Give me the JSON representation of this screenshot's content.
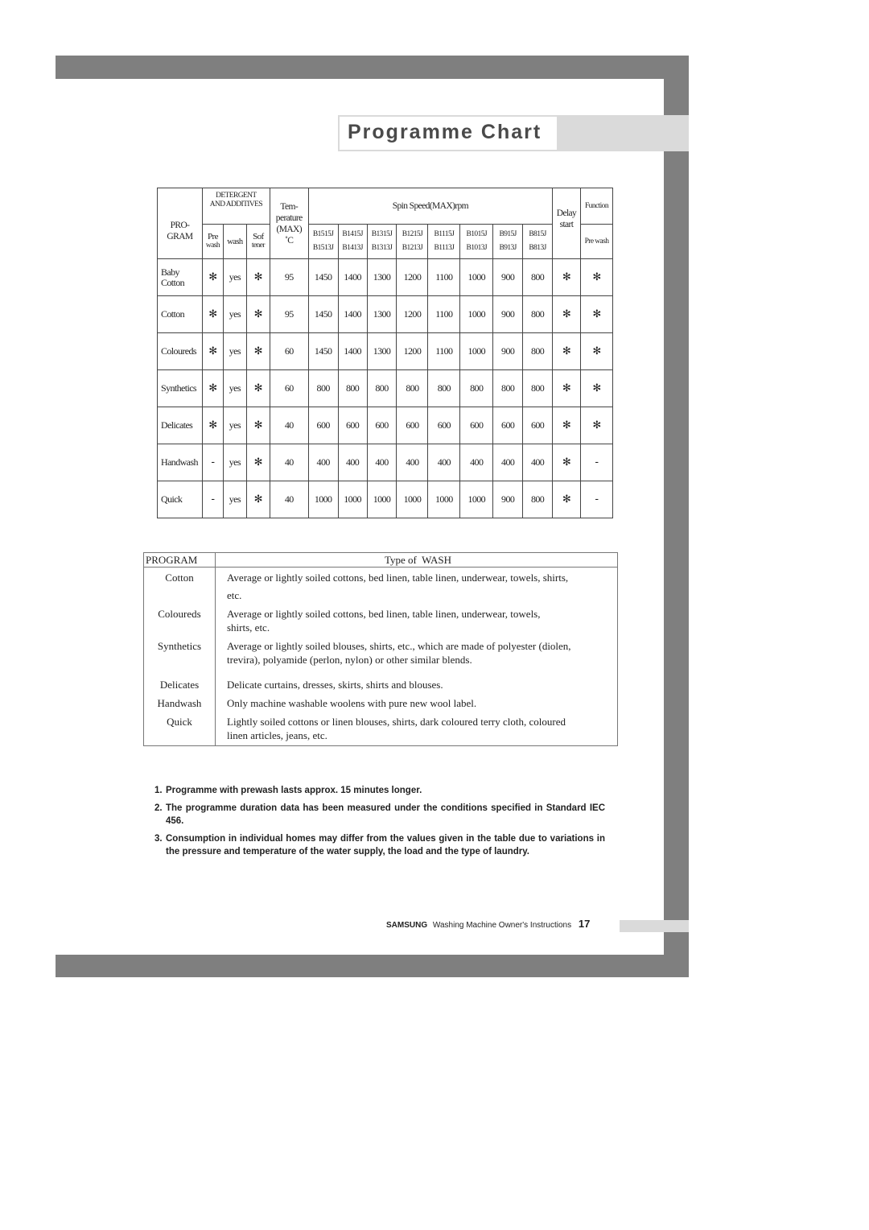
{
  "title": "Programme Chart",
  "program_table": {
    "headers": {
      "program": "PRO-GRAM",
      "program_line1": "PRO-",
      "program_line2": "GRAM",
      "detergent_line1": "DETERGENT",
      "detergent_line2": "AND ADDITIVES",
      "prewash_line1": "Pre",
      "prewash_line2": "wash",
      "wash": "wash",
      "softener_line1": "Sof",
      "softener_line2": "tener",
      "temp_line1": "Tem-",
      "temp_line2": "perature",
      "temp_line3": "(MAX)",
      "temp_line4": "˚C",
      "spin": "Spin Speed(MAX)rpm",
      "delay_line1": "Delay",
      "delay_line2": "start",
      "function": "Function",
      "function_prewash": "Pre wash"
    },
    "models": [
      {
        "top": "B1515J",
        "bottom": "B1513J"
      },
      {
        "top": "B1415J",
        "bottom": "B1413J"
      },
      {
        "top": "B1315J",
        "bottom": "B1313J"
      },
      {
        "top": "B1215J",
        "bottom": "B1213J"
      },
      {
        "top": "B1115J",
        "bottom": "B1113J"
      },
      {
        "top": "B1015J",
        "bottom": "B1013J"
      },
      {
        "top": "B915J",
        "bottom": "B913J"
      },
      {
        "top": "B815J",
        "bottom": "B813J"
      }
    ],
    "rows": [
      {
        "program_line1": "Baby",
        "program_line2": "Cotton",
        "prewash": "✻",
        "wash": "yes",
        "softener": "✻",
        "temp": "95",
        "spin": [
          "1450",
          "1400",
          "1300",
          "1200",
          "1100",
          "1000",
          "900",
          "800"
        ],
        "delay": "✻",
        "prewash_fn": "✻"
      },
      {
        "program_line1": "",
        "program_line2": "Cotton",
        "prewash": "✻",
        "wash": "yes",
        "softener": "✻",
        "temp": "95",
        "spin": [
          "1450",
          "1400",
          "1300",
          "1200",
          "1100",
          "1000",
          "900",
          "800"
        ],
        "delay": "✻",
        "prewash_fn": "✻"
      },
      {
        "program_line1": "",
        "program_line2": "Coloureds",
        "prewash": "✻",
        "wash": "yes",
        "softener": "✻",
        "temp": "60",
        "spin": [
          "1450",
          "1400",
          "1300",
          "1200",
          "1100",
          "1000",
          "900",
          "800"
        ],
        "delay": "✻",
        "prewash_fn": "✻"
      },
      {
        "program_line1": "",
        "program_line2": "Synthetics",
        "prewash": "✻",
        "wash": "yes",
        "softener": "✻",
        "temp": "60",
        "spin": [
          "800",
          "800",
          "800",
          "800",
          "800",
          "800",
          "800",
          "800"
        ],
        "delay": "✻",
        "prewash_fn": "✻"
      },
      {
        "program_line1": "",
        "program_line2": "Delicates",
        "prewash": "✻",
        "wash": "yes",
        "softener": "✻",
        "temp": "40",
        "spin": [
          "600",
          "600",
          "600",
          "600",
          "600",
          "600",
          "600",
          "600"
        ],
        "delay": "✻",
        "prewash_fn": "✻"
      },
      {
        "program_line1": "",
        "program_line2": "Handwash",
        "prewash": "-",
        "wash": "yes",
        "softener": "✻",
        "temp": "40",
        "spin": [
          "400",
          "400",
          "400",
          "400",
          "400",
          "400",
          "400",
          "400"
        ],
        "delay": "✻",
        "prewash_fn": "-"
      },
      {
        "program_line1": "",
        "program_line2": "Quick",
        "prewash": "-",
        "wash": "yes",
        "softener": "✻",
        "temp": "40",
        "spin": [
          "1000",
          "1000",
          "1000",
          "1000",
          "1000",
          "1000",
          "900",
          "800"
        ],
        "delay": "✻",
        "prewash_fn": "-"
      }
    ]
  },
  "wash_table": {
    "header_program": "PROGRAM",
    "header_type": "Type of  WASH",
    "rows": [
      {
        "program": "Cotton",
        "lines": [
          "Average or lightly soiled cottons, bed linen, table linen, underwear, towels, shirts,",
          "etc."
        ]
      },
      {
        "program": "Coloureds",
        "lines": [
          "Average or lightly soiled cottons, bed linen, table linen, underwear, towels,",
          "shirts, etc."
        ]
      },
      {
        "program": "Synthetics",
        "lines": [
          "Average or lightly soiled blouses, shirts, etc., which are made of polyester (diolen,",
          "trevira), polyamide (perlon, nylon) or other similar blends."
        ]
      },
      {
        "program": "Delicates",
        "lines": [
          "Delicate curtains, dresses, skirts, shirts and blouses."
        ]
      },
      {
        "program": "Handwash",
        "lines": [
          "Only machine washable woolens with pure new wool label."
        ]
      },
      {
        "program": "Quick",
        "lines": [
          "Lightly soiled cottons or linen blouses, shirts, dark coloured terry cloth, coloured",
          "linen articles, jeans, etc."
        ]
      }
    ]
  },
  "notes": [
    {
      "num": "1.",
      "text": "Programme with prewash lasts approx. 15 minutes longer."
    },
    {
      "num": "2.",
      "text": "The programme duration data has been measured under the conditions specified in Standard IEC 456."
    },
    {
      "num": "3.",
      "text": "Consumption in individual homes may differ from the values given in the table due to variations in the pressure and temperature of the water supply, the load and the type of laundry."
    }
  ],
  "footer": {
    "brand": "SAMSUNG",
    "text": "Washing Machine Owner's Instructions",
    "page": "17"
  },
  "colors": {
    "frame_dark": "#7f7f7f",
    "frame_light": "#dadada",
    "title_text": "#4a4a4a"
  }
}
